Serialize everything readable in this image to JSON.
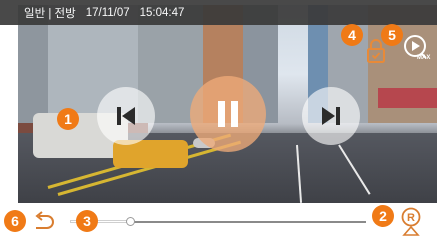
{
  "status_bar": {
    "mode": "일반 | 전방",
    "date": "17/11/07",
    "time": "15:04:47"
  },
  "callouts": [
    "1",
    "2",
    "3",
    "4",
    "5",
    "6"
  ],
  "controls": {
    "previous": "previous-icon",
    "play_pause": "pause-icon",
    "next": "next-icon",
    "lock": "lock-icon",
    "zoom": "zoom-max-icon",
    "zoom_label": "MAX",
    "back": "back-icon",
    "record": "record-icon"
  },
  "playback": {
    "progress": 0.1
  },
  "colors": {
    "callout": "#f07a16",
    "status_bar": "#3a3a3a",
    "pause_button": "#eeaa78"
  }
}
